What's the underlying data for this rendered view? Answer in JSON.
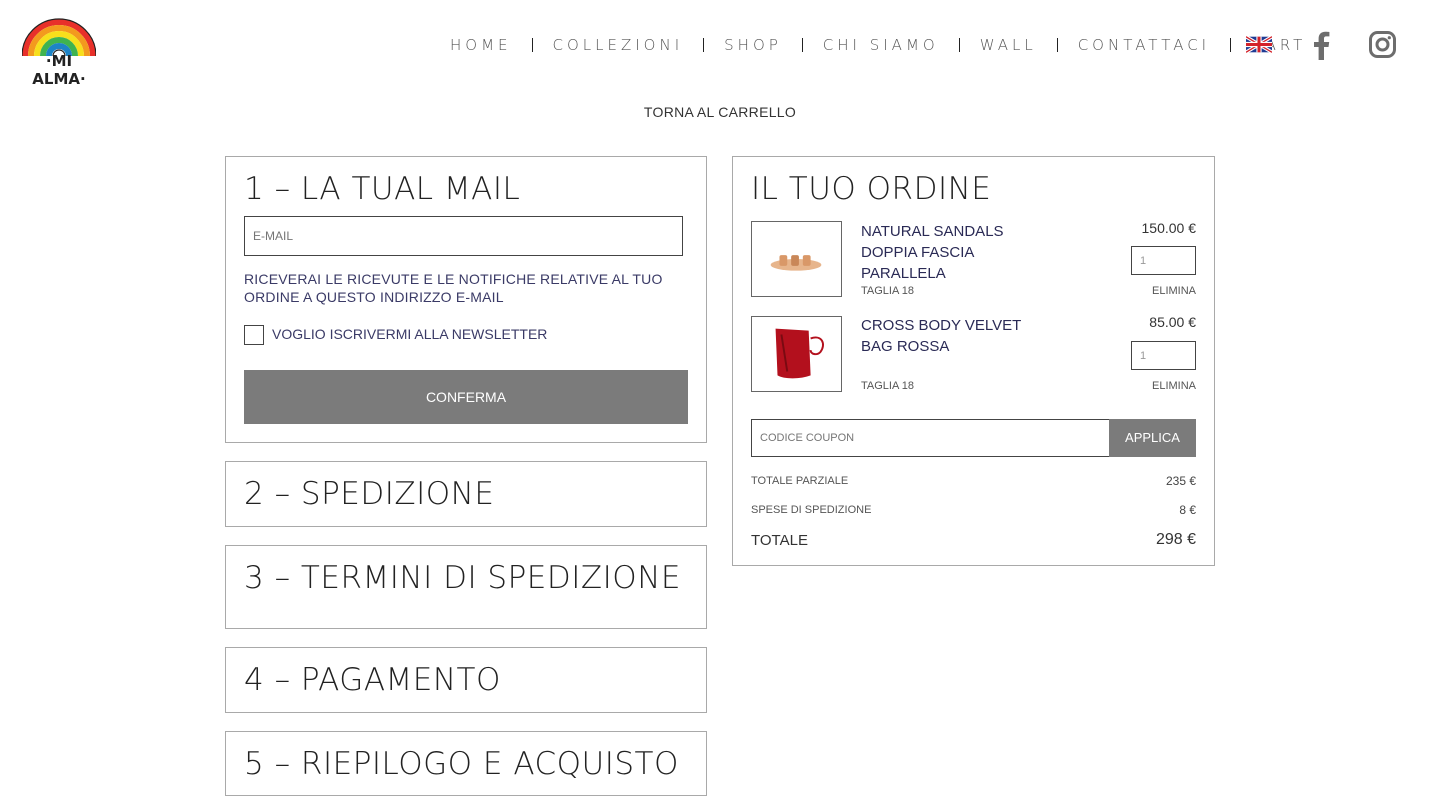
{
  "header": {
    "logo_text": "·MI ALMA·",
    "nav": [
      "HOME",
      "COLLEZIONI",
      "SHOP",
      "CHI SIAMO",
      "WALL",
      "CONTATTACI",
      "CART"
    ],
    "icons": [
      "uk-flag-icon",
      "facebook-icon",
      "instagram-icon"
    ]
  },
  "back_link": "TORNA AL CARRELLO",
  "steps": {
    "email": {
      "title": "1 – La tual mail",
      "placeholder": "E-MAIL",
      "notice": "Riceverai le ricevute e le notifiche relative al tuo ordine a questo indirizzo e-mail",
      "newsletter_label": "Voglio iscrivermi alla newsletter",
      "confirm_label": "Conferma"
    },
    "shipping": {
      "title": "2 – Spedizione"
    },
    "terms": {
      "title": "3 – Termini di spedizione"
    },
    "payment": {
      "title": "4 – Pagamento"
    },
    "summary": {
      "title": "5 – Riepilogo e acquisto"
    }
  },
  "order": {
    "title": "Il tuo ordine",
    "items": [
      {
        "name": "Natural Sandals Doppia Fascia Parallela",
        "price": "150.00 €",
        "qty": "1",
        "size": "Taglia 18",
        "remove": "Elimina"
      },
      {
        "name": "Cross Body Velvet Bag Rossa",
        "price": "85.00 €",
        "qty": "1",
        "size": "Taglia 18",
        "remove": "Elimina"
      }
    ],
    "coupon_placeholder": "CODICE COUPON",
    "coupon_button": "Applica",
    "subtotal_label": "Totale parziale",
    "subtotal_value": "235 €",
    "shipping_label": "Spese di spedizione",
    "shipping_value": "8 €",
    "total_label": "Totale",
    "total_value": "298 €"
  },
  "colors": {
    "button_gray": "#7b7b7b",
    "border_gray": "#a9a9a9",
    "rainbow": [
      "#e8302a",
      "#f39a1e",
      "#f7df1c",
      "#3fb34f",
      "#1d84c6",
      "#6b3fa0"
    ]
  }
}
